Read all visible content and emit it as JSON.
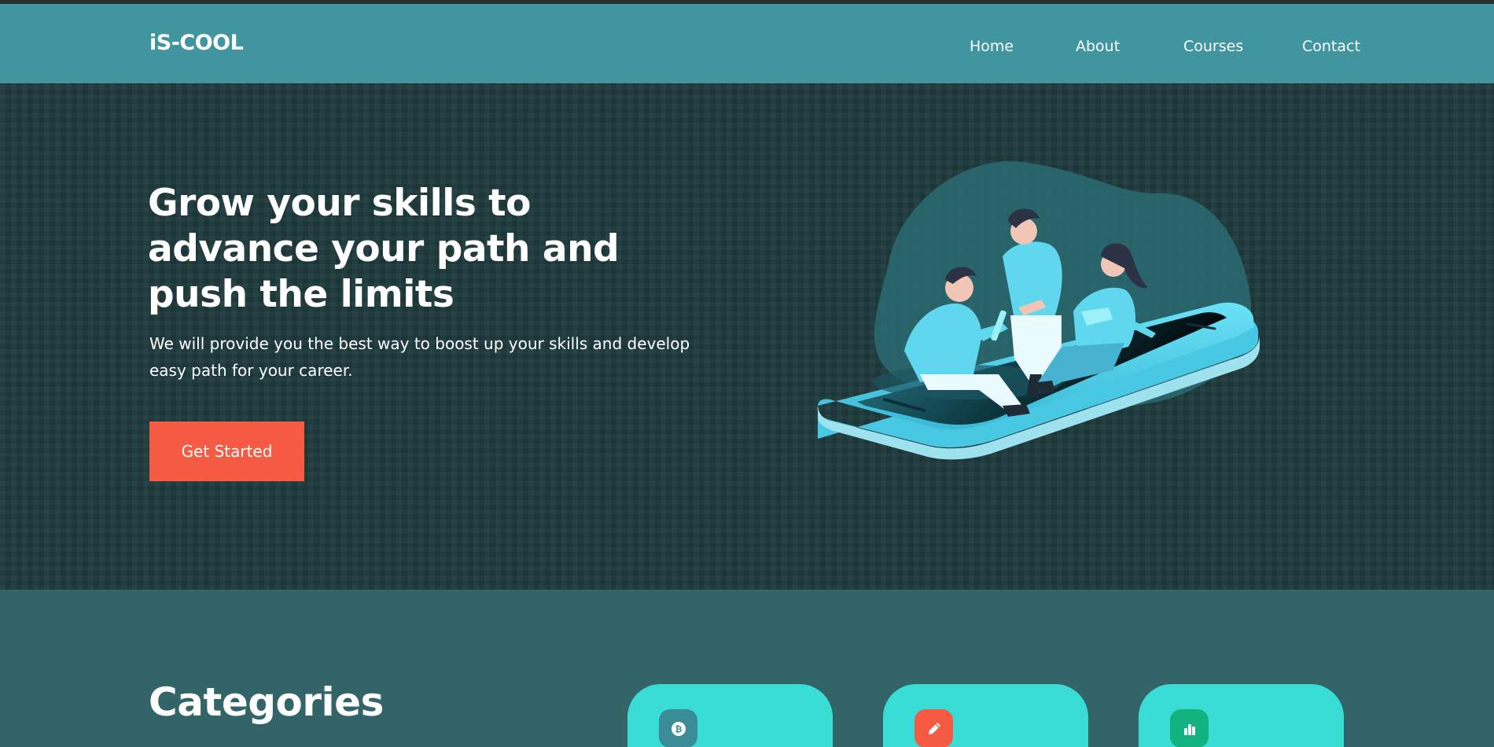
{
  "brand": "iS-COOL",
  "nav": {
    "home": "Home",
    "about": "About",
    "courses": "Courses",
    "contact": "Contact"
  },
  "hero": {
    "title": "Grow your skills to advance your path and push the limits",
    "subtitle": "We will provide you the best way to boost up your skills and develop easy path for your career.",
    "cta_label": "Get Started",
    "illustration": "people-on-phone-illustration"
  },
  "categories": {
    "title": "Categories",
    "cards": [
      {
        "icon": "bitcoin-icon",
        "icon_color": "#3a8c96"
      },
      {
        "icon": "pencil-icon",
        "icon_color": "#f55a43"
      },
      {
        "icon": "bar-chart-icon",
        "icon_color": "#13b37f"
      }
    ]
  },
  "colors": {
    "navbar": "#41959f",
    "hero_bg": "#1f3b3d",
    "accent": "#f55a43",
    "card": "#39ddd5",
    "categories_bg": "#336468"
  }
}
